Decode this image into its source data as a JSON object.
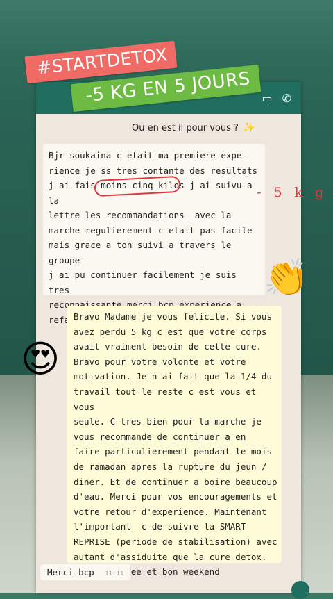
{
  "story_tags": {
    "hashtag": "#STARTDETOX",
    "weight_loss": "-5 KG EN 5 JOURS"
  },
  "question": {
    "text": "Ou en est il pour vous ?",
    "emoji": "✨"
  },
  "client_message": {
    "text": "Bjr soukaina c etait ma premiere expe-\nrience je ss tres contante des resultats\nj ai fais moins cinq kilos j ai suivu a la\nlettre les recommandations  avec la\nmarche regulierement c etait pas facile\nmais grace a ton suivi a travers le groupe\nj ai pu continuer facilement je suis tres\nreconnaissante merci bcp experience a\nrefaire et a recommander ",
    "emojis": "👍👍👍",
    "annotation": "- 5 k g"
  },
  "reaction_clap": "👏",
  "coach_message": {
    "text": "Bravo Madame je vous felicite. Si vous\navez perdu 5 kg c est que votre corps\navait vraiment besoin de cette cure.\nBravo pour votre volonte et votre\nmotivation. Je n ai fait que la 1/4 du\ntravail tout le reste c est vous et vous\nseule. C tres bien pour la marche je\nvous recommande de continuer a en\nfaire particulierement pendant le mois\nde ramadan apres la rupture du jeun /\ndiner. Et de continuer a boire beaucoup\nd'eau. Merci pour vos encouragements et\nvotre retour d'experience. Maintenant\nl'important  c de suivre la SMART\nREPRISE (periode de stabilisation) avec\nautant d'assiduite que la cure detox.\nBonne journee et bon weekend"
  },
  "reaction_heart_eyes": "😍",
  "thanks_message": {
    "text": "Merci bcp",
    "time": "11:11"
  }
}
